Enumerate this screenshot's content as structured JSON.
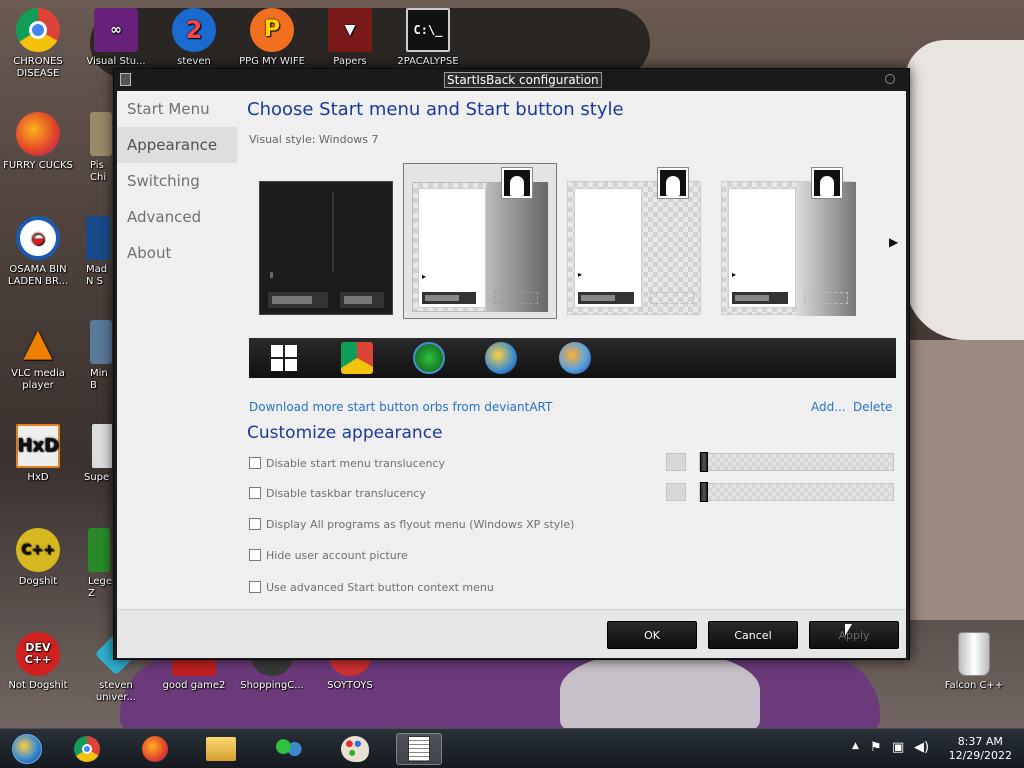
{
  "desktop": {
    "icons": [
      {
        "label": "CHRONES DISEASE",
        "icon": "chrome-icon"
      },
      {
        "label": "Visual Stu...",
        "icon": "visual-studio-icon"
      },
      {
        "label": "steven",
        "icon": "steven-icon"
      },
      {
        "label": "PPG MY WIFE",
        "icon": "ppg-icon"
      },
      {
        "label": "Papers",
        "icon": "papers-icon"
      },
      {
        "label": "2PACALYPSE",
        "icon": "cmd-icon"
      },
      {
        "label": "FURRY CUCKS",
        "icon": "firefox-icon"
      },
      {
        "label": "Pis Chi",
        "icon": "pis-icon"
      },
      {
        "label": "OSAMA BIN LADEN BR...",
        "icon": "obama-logo-icon"
      },
      {
        "label": "Mad N S",
        "icon": "mad-icon"
      },
      {
        "label": "VLC media player",
        "icon": "vlc-icon"
      },
      {
        "label": "Min B",
        "icon": "min-icon"
      },
      {
        "label": "HxD",
        "icon": "hxd-icon"
      },
      {
        "label": "Supe",
        "icon": "supe-icon"
      },
      {
        "label": "Dogshit",
        "icon": "cpp-icon"
      },
      {
        "label": "Lege Z",
        "icon": "lege-icon"
      },
      {
        "label": "Not Dogshit",
        "icon": "dev-cpp-icon"
      },
      {
        "label": "steven univer...",
        "icon": "gem-icon"
      },
      {
        "label": "good game2",
        "icon": "good-game-icon"
      },
      {
        "label": "ShoppingC...",
        "icon": "shopping-icon"
      },
      {
        "label": "SOYTOYS",
        "icon": "soytoys-icon"
      },
      {
        "label": "Falcon C++",
        "icon": "recycle-bin-icon"
      }
    ]
  },
  "taskbar": {
    "apps": [
      "start-orb-icon",
      "chrome-icon",
      "firefox-icon",
      "explorer-icon",
      "messenger-icon",
      "paint-icon",
      "startisback-icon"
    ],
    "clock_time": "8:37 AM",
    "clock_date": "12/29/2022"
  },
  "window": {
    "title": "StartIsBack configuration",
    "nav": [
      "Start Menu",
      "Appearance",
      "Switching",
      "Advanced",
      "About"
    ],
    "active_nav": "Appearance",
    "heading": "Choose Start menu and Start button style",
    "visual_style_label": "Visual style:",
    "visual_style_value": "Windows 7",
    "download_link": "Download more start button orbs from deviantART",
    "add_link": "Add...",
    "delete_link": "Delete",
    "customize_heading": "Customize appearance",
    "options": [
      {
        "label": "Disable start menu translucency",
        "checked": false
      },
      {
        "label": "Disable taskbar translucency",
        "checked": false
      },
      {
        "label": "Display All programs as flyout menu (Windows XP style)",
        "checked": false
      },
      {
        "label": "Hide user account picture",
        "checked": false
      },
      {
        "label": "Use advanced Start button context menu",
        "checked": false
      }
    ],
    "buttons": {
      "ok": "OK",
      "cancel": "Cancel",
      "apply": "Apply"
    }
  },
  "colors": {
    "heading": "#1a3a9a",
    "link": "#2a72c8",
    "window_frame": "#1b1b1b",
    "client_bg": "#efefef"
  }
}
